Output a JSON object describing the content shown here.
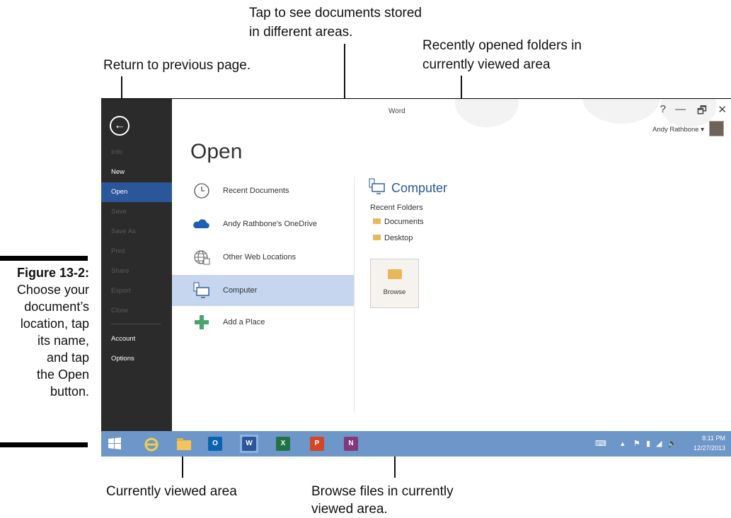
{
  "callouts": {
    "tap_areas_1": "Tap to see documents stored",
    "tap_areas_2": "in different areas.",
    "recent_folders_1": "Recently opened folders in",
    "recent_folders_2": "currently viewed area",
    "return_prev": "Return to previous page.",
    "currently_viewed": "Currently viewed area",
    "browse_1": "Browse files in currently",
    "browse_2": "viewed area."
  },
  "figure": {
    "number": "Figure 13-2:",
    "caption_lines": [
      "Choose your",
      "document’s",
      "location, tap",
      "its name,",
      "and tap",
      "the Open",
      "button."
    ]
  },
  "app": {
    "title": "Word",
    "user_name": "Andy Rathbone",
    "help": "?",
    "minimize": "—",
    "restore": "🗗",
    "close": "✕"
  },
  "backstage": {
    "back_icon": "arrow-left-icon",
    "items": [
      {
        "label": "Info"
      },
      {
        "label": "New"
      },
      {
        "label": "Open"
      },
      {
        "label": "Save"
      },
      {
        "label": "Save As"
      },
      {
        "label": "Print"
      },
      {
        "label": "Share"
      },
      {
        "label": "Export"
      },
      {
        "label": "Close"
      },
      {
        "label": "Account"
      },
      {
        "label": "Options"
      }
    ]
  },
  "main": {
    "title": "Open",
    "places": [
      {
        "label": "Recent Documents",
        "icon": "clock-icon"
      },
      {
        "label": "Andy Rathbone's OneDrive",
        "icon": "cloud-icon"
      },
      {
        "label": "Other Web Locations",
        "icon": "globe-icon"
      },
      {
        "label": "Computer",
        "icon": "computer-icon"
      },
      {
        "label": "Add a Place",
        "icon": "plus-icon"
      }
    ],
    "location": {
      "header": "Computer",
      "recent_label": "Recent Folders",
      "folders": [
        {
          "label": "Documents"
        },
        {
          "label": "Desktop"
        }
      ],
      "browse_label": "Browse"
    }
  },
  "taskbar": {
    "apps": [
      {
        "letter": "O",
        "name": "Outlook",
        "color": "#0a64ad"
      },
      {
        "letter": "W",
        "name": "Word",
        "color": "#2b579a"
      },
      {
        "letter": "X",
        "name": "Excel",
        "color": "#217346"
      },
      {
        "letter": "P",
        "name": "PowerPoint",
        "color": "#d24726"
      },
      {
        "letter": "N",
        "name": "OneNote",
        "color": "#80397b"
      }
    ],
    "time": "8:11 PM",
    "date": "12/27/2013"
  }
}
